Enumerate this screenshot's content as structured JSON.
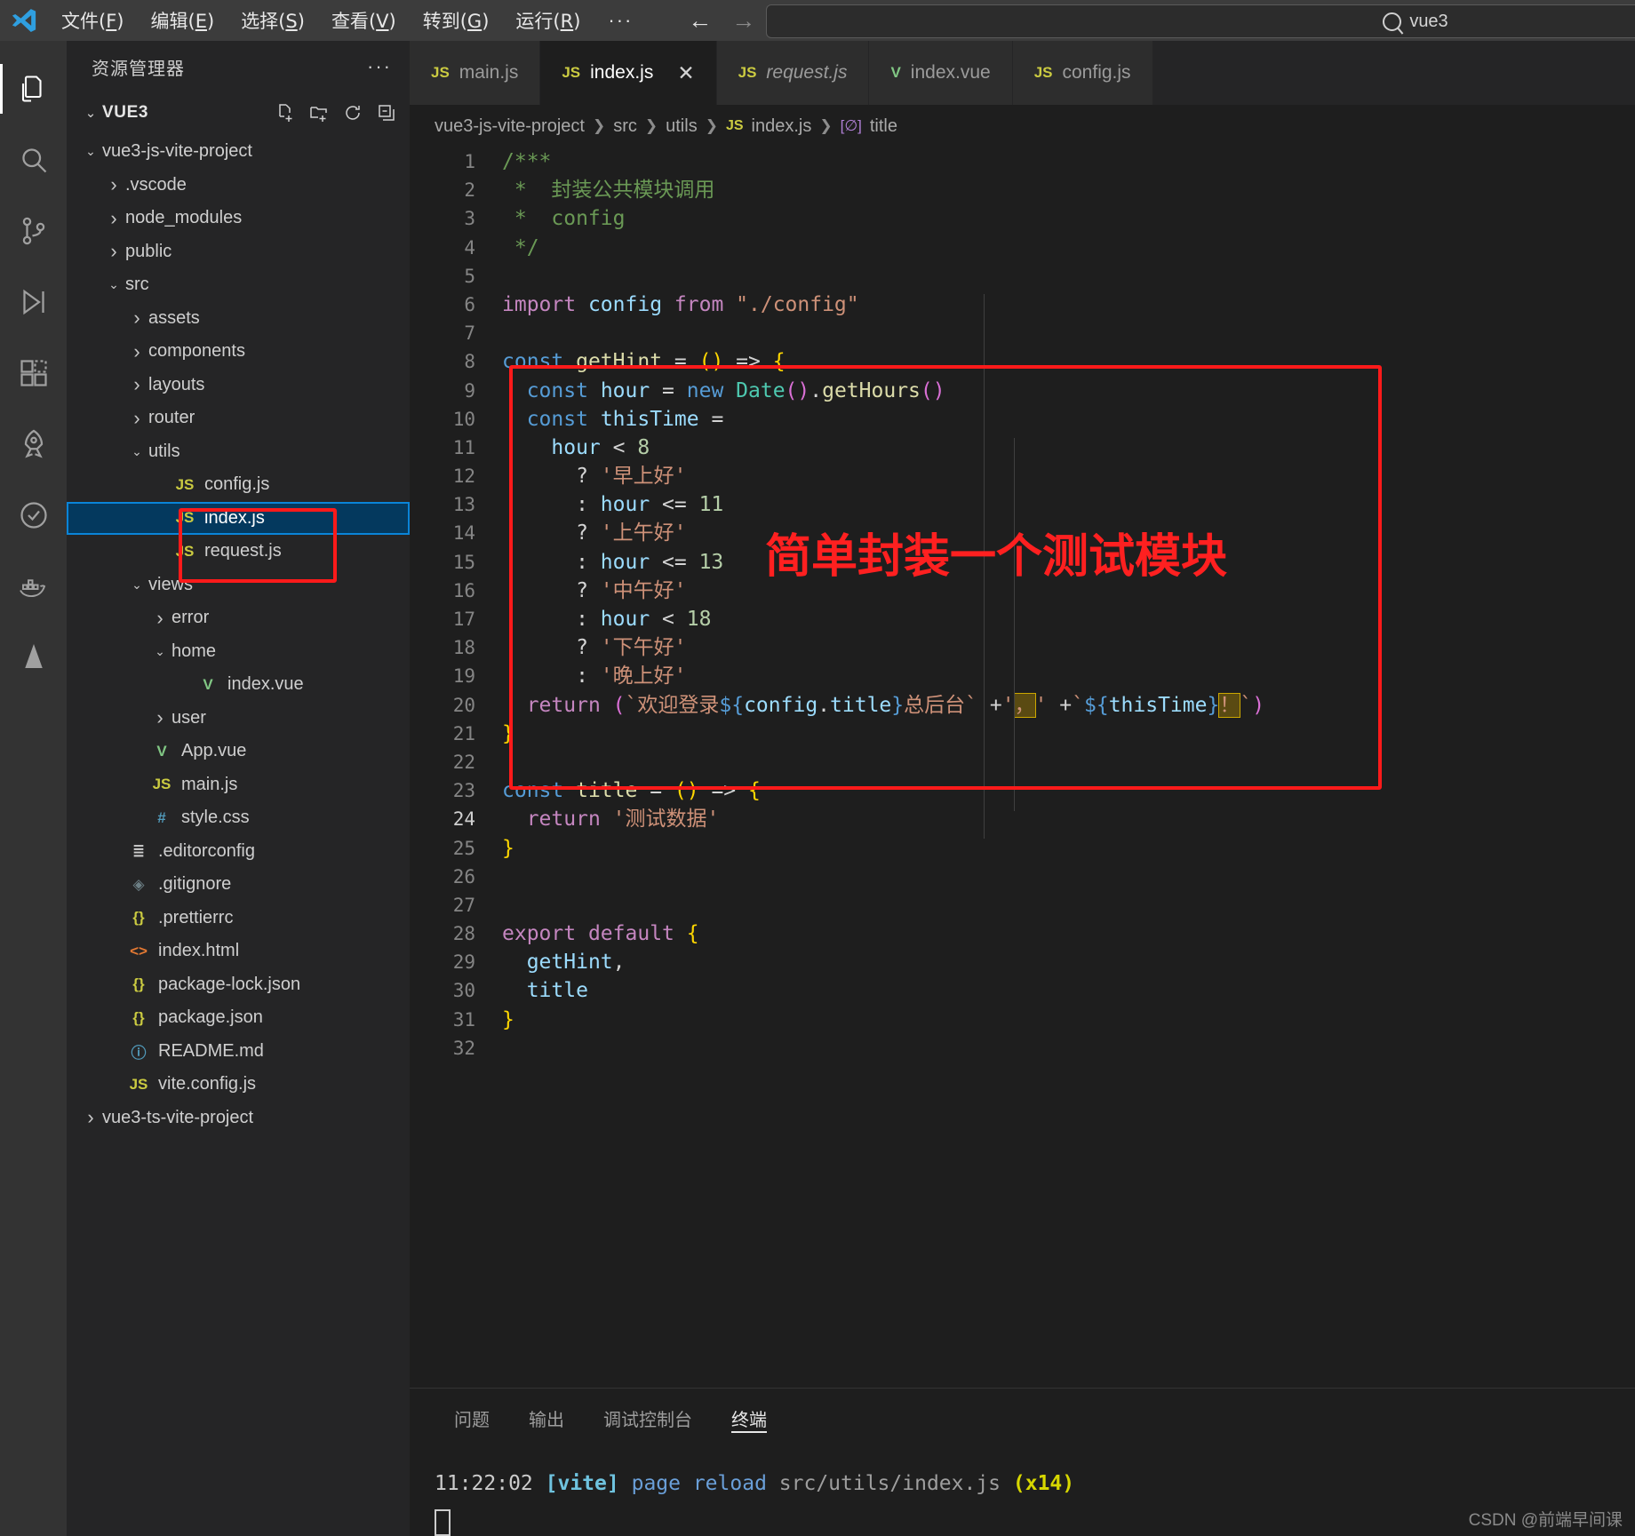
{
  "titlebar": {
    "menu": [
      {
        "label": "文件",
        "mnemonic": "F"
      },
      {
        "label": "编辑",
        "mnemonic": "E"
      },
      {
        "label": "选择",
        "mnemonic": "S"
      },
      {
        "label": "查看",
        "mnemonic": "V"
      },
      {
        "label": "转到",
        "mnemonic": "G"
      },
      {
        "label": "运行",
        "mnemonic": "R"
      }
    ],
    "more_label": "···",
    "back_arrow": "←",
    "forward_arrow": "→",
    "search_value": "vue3"
  },
  "activitybar": {
    "items": [
      {
        "name": "explorer",
        "active": true
      },
      {
        "name": "search",
        "active": false
      },
      {
        "name": "source-control",
        "active": false
      },
      {
        "name": "run-debug",
        "active": false
      },
      {
        "name": "extensions",
        "active": false
      },
      {
        "name": "remote-explorer",
        "active": false
      },
      {
        "name": "test",
        "active": false
      },
      {
        "name": "docker",
        "active": false
      },
      {
        "name": "cone",
        "active": false
      }
    ]
  },
  "sidebar": {
    "title": "资源管理器",
    "more_label": "···",
    "root_label": "VUE3",
    "actions": [
      "new-file",
      "new-folder",
      "refresh",
      "collapse-all"
    ],
    "tree": [
      {
        "label": "vue3-js-vite-project",
        "depth": 0,
        "type": "folder",
        "state": "open"
      },
      {
        "label": ".vscode",
        "depth": 1,
        "type": "folder",
        "state": "closed"
      },
      {
        "label": "node_modules",
        "depth": 1,
        "type": "folder",
        "state": "closed"
      },
      {
        "label": "public",
        "depth": 1,
        "type": "folder",
        "state": "closed"
      },
      {
        "label": "src",
        "depth": 1,
        "type": "folder",
        "state": "open"
      },
      {
        "label": "assets",
        "depth": 2,
        "type": "folder",
        "state": "closed"
      },
      {
        "label": "components",
        "depth": 2,
        "type": "folder",
        "state": "closed"
      },
      {
        "label": "layouts",
        "depth": 2,
        "type": "folder",
        "state": "closed"
      },
      {
        "label": "router",
        "depth": 2,
        "type": "folder",
        "state": "closed"
      },
      {
        "label": "utils",
        "depth": 2,
        "type": "folder",
        "state": "open"
      },
      {
        "label": "config.js",
        "depth": 3,
        "type": "js"
      },
      {
        "label": "index.js",
        "depth": 3,
        "type": "js",
        "selected": true
      },
      {
        "label": "request.js",
        "depth": 3,
        "type": "js"
      },
      {
        "label": "views",
        "depth": 2,
        "type": "folder",
        "state": "open"
      },
      {
        "label": "error",
        "depth": 3,
        "type": "folder",
        "state": "closed"
      },
      {
        "label": "home",
        "depth": 3,
        "type": "folder",
        "state": "open"
      },
      {
        "label": "index.vue",
        "depth": 4,
        "type": "vue"
      },
      {
        "label": "user",
        "depth": 3,
        "type": "folder",
        "state": "closed"
      },
      {
        "label": "App.vue",
        "depth": 2,
        "type": "vue"
      },
      {
        "label": "main.js",
        "depth": 2,
        "type": "js"
      },
      {
        "label": "style.css",
        "depth": 2,
        "type": "css"
      },
      {
        "label": ".editorconfig",
        "depth": 1,
        "type": "cfg"
      },
      {
        "label": ".gitignore",
        "depth": 1,
        "type": "git"
      },
      {
        "label": ".prettierrc",
        "depth": 1,
        "type": "json"
      },
      {
        "label": "index.html",
        "depth": 1,
        "type": "html"
      },
      {
        "label": "package-lock.json",
        "depth": 1,
        "type": "json"
      },
      {
        "label": "package.json",
        "depth": 1,
        "type": "json"
      },
      {
        "label": "README.md",
        "depth": 1,
        "type": "md"
      },
      {
        "label": "vite.config.js",
        "depth": 1,
        "type": "js"
      },
      {
        "label": "vue3-ts-vite-project",
        "depth": 0,
        "type": "folder",
        "state": "closed"
      }
    ]
  },
  "editor": {
    "tabs": [
      {
        "label": "main.js",
        "icon": "js",
        "active": false,
        "italic": false,
        "closable": false
      },
      {
        "label": "index.js",
        "icon": "js",
        "active": true,
        "italic": false,
        "closable": true,
        "close_label": "✕"
      },
      {
        "label": "request.js",
        "icon": "js",
        "active": false,
        "italic": true,
        "closable": false
      },
      {
        "label": "index.vue",
        "icon": "vue",
        "active": false,
        "italic": false,
        "closable": false
      },
      {
        "label": "config.js",
        "icon": "js",
        "active": false,
        "italic": false,
        "closable": false
      }
    ],
    "breadcrumb": [
      "vue3-js-vite-project",
      "src",
      "utils",
      "index.js",
      "title"
    ],
    "breadcrumb_file_icon": "JS",
    "breadcrumb_symbol_icon": "[∅]",
    "active_line": 24,
    "annotation": "简单封装一个测试模块",
    "annotation_color": "#ff2020",
    "lines": [
      {
        "n": 1,
        "tokens": [
          {
            "t": "/***",
            "c": "tk-cmt"
          }
        ]
      },
      {
        "n": 2,
        "tokens": [
          {
            "t": " *  封装公共模块调用",
            "c": "tk-cmt"
          }
        ]
      },
      {
        "n": 3,
        "tokens": [
          {
            "t": " *  config",
            "c": "tk-cmt"
          }
        ]
      },
      {
        "n": 4,
        "tokens": [
          {
            "t": " */",
            "c": "tk-cmt"
          }
        ]
      },
      {
        "n": 5,
        "tokens": []
      },
      {
        "n": 6,
        "tokens": [
          {
            "t": "import",
            "c": "tk-kw"
          },
          {
            "t": " ",
            "c": "tk-op"
          },
          {
            "t": "config",
            "c": "tk-var"
          },
          {
            "t": " ",
            "c": "tk-op"
          },
          {
            "t": "from",
            "c": "tk-kw"
          },
          {
            "t": " ",
            "c": "tk-op"
          },
          {
            "t": "\"./config\"",
            "c": "tk-str"
          }
        ]
      },
      {
        "n": 7,
        "tokens": []
      },
      {
        "n": 8,
        "tokens": [
          {
            "t": "const",
            "c": "tk-kw2"
          },
          {
            "t": " ",
            "c": "tk-op"
          },
          {
            "t": "getHint",
            "c": "tk-fn"
          },
          {
            "t": " = ",
            "c": "tk-op"
          },
          {
            "t": "()",
            "c": "tk-par"
          },
          {
            "t": " => ",
            "c": "tk-op"
          },
          {
            "t": "{",
            "c": "tk-par"
          }
        ]
      },
      {
        "n": 9,
        "tokens": [
          {
            "t": "  ",
            "c": "tk-op"
          },
          {
            "t": "const",
            "c": "tk-kw2"
          },
          {
            "t": " ",
            "c": "tk-op"
          },
          {
            "t": "hour",
            "c": "tk-var"
          },
          {
            "t": " = ",
            "c": "tk-op"
          },
          {
            "t": "new",
            "c": "tk-kw2"
          },
          {
            "t": " ",
            "c": "tk-op"
          },
          {
            "t": "Date",
            "c": "tk-cls"
          },
          {
            "t": "()",
            "c": "tk-par2"
          },
          {
            "t": ".",
            "c": "tk-op"
          },
          {
            "t": "getHours",
            "c": "tk-fn"
          },
          {
            "t": "()",
            "c": "tk-par2"
          }
        ]
      },
      {
        "n": 10,
        "tokens": [
          {
            "t": "  ",
            "c": "tk-op"
          },
          {
            "t": "const",
            "c": "tk-kw2"
          },
          {
            "t": " ",
            "c": "tk-op"
          },
          {
            "t": "thisTime",
            "c": "tk-var"
          },
          {
            "t": " =",
            "c": "tk-op"
          }
        ]
      },
      {
        "n": 11,
        "tokens": [
          {
            "t": "    ",
            "c": "tk-op"
          },
          {
            "t": "hour",
            "c": "tk-var"
          },
          {
            "t": " < ",
            "c": "tk-op"
          },
          {
            "t": "8",
            "c": "tk-num"
          }
        ]
      },
      {
        "n": 12,
        "tokens": [
          {
            "t": "      ? ",
            "c": "tk-op"
          },
          {
            "t": "'早上好'",
            "c": "tk-str"
          }
        ]
      },
      {
        "n": 13,
        "tokens": [
          {
            "t": "      : ",
            "c": "tk-op"
          },
          {
            "t": "hour",
            "c": "tk-var"
          },
          {
            "t": " <= ",
            "c": "tk-op"
          },
          {
            "t": "11",
            "c": "tk-num"
          }
        ]
      },
      {
        "n": 14,
        "tokens": [
          {
            "t": "      ? ",
            "c": "tk-op"
          },
          {
            "t": "'上午好'",
            "c": "tk-str"
          }
        ]
      },
      {
        "n": 15,
        "tokens": [
          {
            "t": "      : ",
            "c": "tk-op"
          },
          {
            "t": "hour",
            "c": "tk-var"
          },
          {
            "t": " <= ",
            "c": "tk-op"
          },
          {
            "t": "13",
            "c": "tk-num"
          }
        ]
      },
      {
        "n": 16,
        "tokens": [
          {
            "t": "      ? ",
            "c": "tk-op"
          },
          {
            "t": "'中午好'",
            "c": "tk-str"
          }
        ]
      },
      {
        "n": 17,
        "tokens": [
          {
            "t": "      : ",
            "c": "tk-op"
          },
          {
            "t": "hour",
            "c": "tk-var"
          },
          {
            "t": " < ",
            "c": "tk-op"
          },
          {
            "t": "18",
            "c": "tk-num"
          }
        ]
      },
      {
        "n": 18,
        "tokens": [
          {
            "t": "      ? ",
            "c": "tk-op"
          },
          {
            "t": "'下午好'",
            "c": "tk-str"
          }
        ]
      },
      {
        "n": 19,
        "tokens": [
          {
            "t": "      : ",
            "c": "tk-op"
          },
          {
            "t": "'晚上好'",
            "c": "tk-str"
          }
        ]
      },
      {
        "n": 20,
        "tokens": [
          {
            "t": "  ",
            "c": "tk-op"
          },
          {
            "t": "return",
            "c": "tk-kw"
          },
          {
            "t": " ",
            "c": "tk-op"
          },
          {
            "t": "(",
            "c": "tk-par2"
          },
          {
            "t": "`欢迎登录",
            "c": "tk-str"
          },
          {
            "t": "${",
            "c": "tk-tmpl"
          },
          {
            "t": "config",
            "c": "tk-var"
          },
          {
            "t": ".",
            "c": "tk-op"
          },
          {
            "t": "title",
            "c": "tk-var"
          },
          {
            "t": "}",
            "c": "tk-tmpl"
          },
          {
            "t": "总后台`",
            "c": "tk-str"
          },
          {
            "t": " +",
            "c": "tk-op"
          },
          {
            "t": "'",
            "c": "tk-str"
          },
          {
            "t": "，",
            "c": "hl-box"
          },
          {
            "t": "'",
            "c": "tk-str"
          },
          {
            "t": " +",
            "c": "tk-op"
          },
          {
            "t": "`",
            "c": "tk-str"
          },
          {
            "t": "${",
            "c": "tk-tmpl"
          },
          {
            "t": "thisTime",
            "c": "tk-var"
          },
          {
            "t": "}",
            "c": "tk-tmpl"
          },
          {
            "t": "！",
            "c": "hl-box"
          },
          {
            "t": "`",
            "c": "tk-str"
          },
          {
            "t": ")",
            "c": "tk-par2"
          }
        ]
      },
      {
        "n": 21,
        "tokens": [
          {
            "t": "}",
            "c": "tk-par"
          }
        ]
      },
      {
        "n": 22,
        "tokens": []
      },
      {
        "n": 23,
        "tokens": [
          {
            "t": "const",
            "c": "tk-kw2"
          },
          {
            "t": " ",
            "c": "tk-op"
          },
          {
            "t": "title",
            "c": "tk-fn"
          },
          {
            "t": " = ",
            "c": "tk-op"
          },
          {
            "t": "()",
            "c": "tk-par"
          },
          {
            "t": " => ",
            "c": "tk-op"
          },
          {
            "t": "{",
            "c": "tk-par"
          }
        ]
      },
      {
        "n": 24,
        "tokens": [
          {
            "t": "  ",
            "c": "tk-op"
          },
          {
            "t": "return",
            "c": "tk-kw"
          },
          {
            "t": " ",
            "c": "tk-op"
          },
          {
            "t": "'测试数据'",
            "c": "tk-str"
          }
        ]
      },
      {
        "n": 25,
        "tokens": [
          {
            "t": "}",
            "c": "tk-par"
          }
        ]
      },
      {
        "n": 26,
        "tokens": []
      },
      {
        "n": 27,
        "tokens": []
      },
      {
        "n": 28,
        "tokens": [
          {
            "t": "export",
            "c": "tk-kw"
          },
          {
            "t": " ",
            "c": "tk-op"
          },
          {
            "t": "default",
            "c": "tk-kw"
          },
          {
            "t": " ",
            "c": "tk-op"
          },
          {
            "t": "{",
            "c": "tk-par"
          }
        ]
      },
      {
        "n": 29,
        "tokens": [
          {
            "t": "  ",
            "c": "tk-op"
          },
          {
            "t": "getHint",
            "c": "tk-var"
          },
          {
            "t": ",",
            "c": "tk-op"
          }
        ]
      },
      {
        "n": 30,
        "tokens": [
          {
            "t": "  ",
            "c": "tk-op"
          },
          {
            "t": "title",
            "c": "tk-var"
          }
        ]
      },
      {
        "n": 31,
        "tokens": [
          {
            "t": "}",
            "c": "tk-par"
          }
        ]
      },
      {
        "n": 32,
        "tokens": []
      }
    ]
  },
  "panel": {
    "tabs": [
      {
        "label": "问题",
        "active": false
      },
      {
        "label": "输出",
        "active": false
      },
      {
        "label": "调试控制台",
        "active": false
      },
      {
        "label": "终端",
        "active": true
      }
    ],
    "terminal": {
      "time": "11:22:02",
      "tag": "[vite]",
      "action": "page reload",
      "path": "src/utils/index.js",
      "count": "(x14)"
    }
  },
  "watermark": "CSDN @前端早间课"
}
